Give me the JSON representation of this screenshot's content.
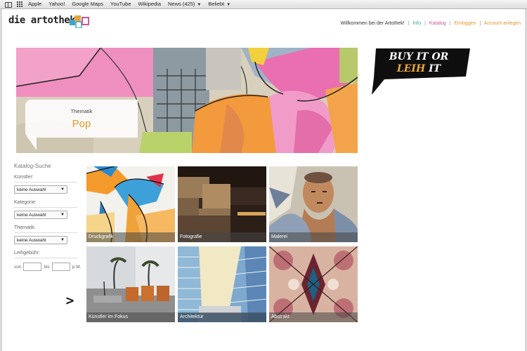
{
  "bookmarks": {
    "items": [
      "Apple",
      "Yahoo!",
      "Google Maps",
      "YouTube",
      "Wikipedia",
      "News (425)",
      "Beliebt"
    ]
  },
  "site": {
    "logo_text": "die artothek",
    "welcome": "Willkommen bei der Artothek!",
    "nav": {
      "info": "Info",
      "katalog": "Katalog",
      "login": "Einloggen",
      "account": "Account anlegen"
    }
  },
  "hero": {
    "label": "Thematik",
    "value": "Pop"
  },
  "badge": {
    "line1": "BUY IT OR",
    "line2_highlight": "LEIH",
    "line2_rest": " IT"
  },
  "search": {
    "title": "Katalog-Suche",
    "kuenstler_label": "Künstler:",
    "kuenstler_value": "keine Auswahl",
    "kategorie_label": "Kategorie:",
    "kategorie_value": "keine Auswahl",
    "thematik_label": "Thematik:",
    "thematik_value": "keine Auswahl",
    "leihgebuehr_label": "Leihgebühr:",
    "von": "von",
    "bis": "bis",
    "unit": "p.M.",
    "submit_glyph": ">"
  },
  "tiles": [
    {
      "caption": "Druckgrafik"
    },
    {
      "caption": "Fotografie"
    },
    {
      "caption": "Malerei"
    },
    {
      "caption": "Künstler im Fokus"
    },
    {
      "caption": "Architektur"
    },
    {
      "caption": "Abstrakt"
    }
  ],
  "colors": {
    "accent_orange": "#e39a2e",
    "link_teal": "#35a7b5",
    "link_magenta": "#c45a9c"
  }
}
